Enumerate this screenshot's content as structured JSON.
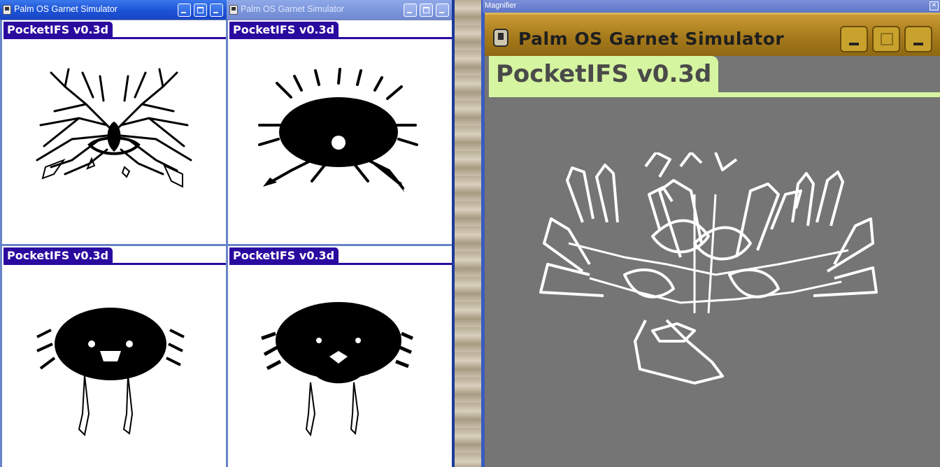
{
  "desktop": {
    "background": "#6f7ea8"
  },
  "sim_windows": [
    {
      "title": "Palm OS Garnet Simulator",
      "app_title": "PocketIFS v0.3d",
      "active": true
    },
    {
      "title": "Palm OS Garnet Simulator",
      "app_title": "PocketIFS v0.3d",
      "active": false
    }
  ],
  "panes": [
    {
      "app_title": "PocketIFS v0.3d"
    },
    {
      "app_title": "PocketIFS v0.3d"
    },
    {
      "app_title": "PocketIFS v0.3d"
    },
    {
      "app_title": "PocketIFS v0.3d"
    }
  ],
  "magnifier": {
    "title": "Magnifier",
    "inner_window_title": "Palm OS Garnet Simulator",
    "app_title": "PocketIFS v0.3d",
    "close_glyph": "✕"
  },
  "icons": [
    "palm-app-icon",
    "minimize-icon",
    "maximize-icon",
    "close-icon",
    "magnifier-close-icon"
  ],
  "colors": {
    "xp_title": "#1f5bd8",
    "palm_header": "#2b0aa0",
    "mag_canvas": "#757575",
    "mag_header": "#d5f5a0"
  }
}
